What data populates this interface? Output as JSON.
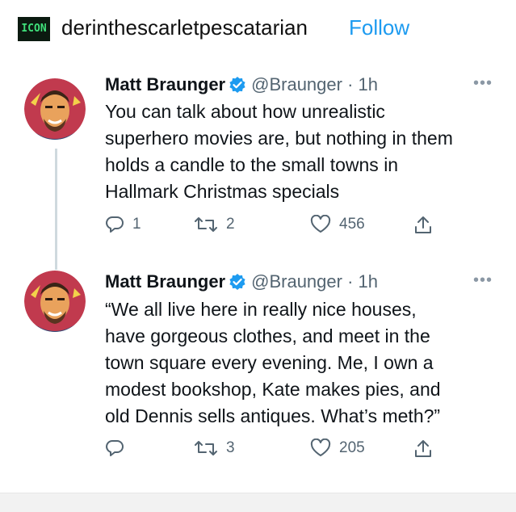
{
  "post": {
    "blog_icon_text": "ICON",
    "blog_name": "derinthescarletpescatarian",
    "follow_label": "Follow"
  },
  "tweets": [
    {
      "author": "Matt Braunger",
      "handle": "@Braunger",
      "time": "· 1h",
      "lines": [
        "You can talk about how unrealistic",
        "superhero movies are, but nothing in them",
        "holds a candle to the small towns in",
        "Hallmark Christmas specials"
      ],
      "replies": "1",
      "retweets": "2",
      "likes": "456"
    },
    {
      "author": "Matt Braunger",
      "handle": "@Braunger",
      "time": "· 1h",
      "lines": [
        "“We all live here in really nice houses,",
        "have gorgeous clothes, and meet in the",
        "town square every evening. Me, I own a",
        "modest bookshop, Kate makes pies, and",
        "old Dennis sells antiques. What’s meth?”"
      ],
      "replies": "",
      "retweets": "3",
      "likes": "205"
    }
  ],
  "icons": {
    "verified": "verified-badge-icon",
    "reply": "reply-icon",
    "retweet": "retweet-icon",
    "like": "heart-icon",
    "share": "share-icon",
    "more": "more-icon"
  },
  "colors": {
    "follow": "#1d9bf0",
    "verified": "#1d9bf0",
    "muted": "#536471",
    "blog_icon_bg": "#0b1a10",
    "blog_icon_fg": "#3fe07a"
  }
}
